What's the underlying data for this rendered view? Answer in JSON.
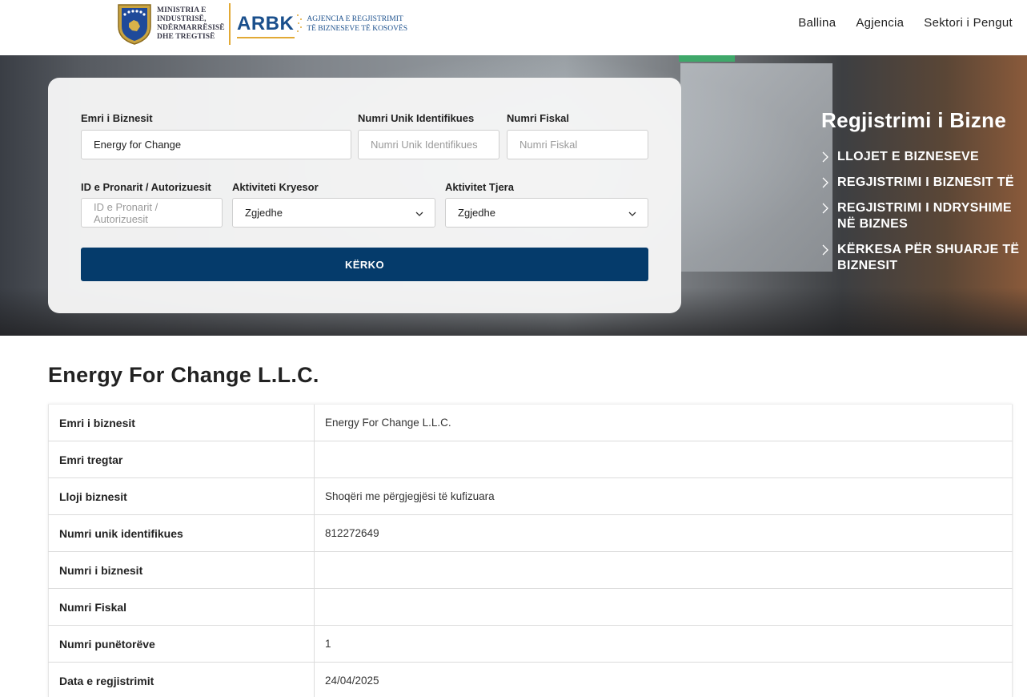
{
  "header": {
    "ministry_line1": "MINISTRIA E",
    "ministry_line2": "INDUSTRISË,",
    "ministry_line3": "NDËRMARRËSISË",
    "ministry_line4": "DHE TREGTISË",
    "arbk": "ARBK",
    "agency_line1": "AGJENCIA E REGJISTRIMIT",
    "agency_line2": "TË BIZNESEVE TË KOSOVËS",
    "nav": [
      "Ballina",
      "Agjencia",
      "Sektori i Pengut"
    ]
  },
  "search": {
    "business_name_label": "Emri i Biznesit",
    "business_name_value": "Energy for Change",
    "nui_label": "Numri Unik Identifikues",
    "nui_placeholder": "Numri Unik Identifikues",
    "fiscal_label": "Numri Fiskal",
    "fiscal_placeholder": "Numri Fiskal",
    "owner_label": "ID e Pronarit / Autorizuesit",
    "owner_placeholder": "ID e Pronarit / Autorizuesit",
    "main_activity_label": "Aktiviteti Kryesor",
    "main_activity_value": "Zgjedhe",
    "other_activity_label": "Aktivitet Tjera",
    "other_activity_value": "Zgjedhe",
    "button": "KËRKO"
  },
  "hero": {
    "title": "Regjistrimi i Bizne",
    "items": [
      [
        "LLOJET E BIZNESEVE"
      ],
      [
        "REGJISTRIMI I BIZNESIT TË"
      ],
      [
        "REGJISTRIMI I NDRYSHIME",
        "NË BIZNES"
      ],
      [
        "KËRKESA PËR SHUARJE TË",
        "BIZNESIT"
      ]
    ]
  },
  "result": {
    "title": "Energy For Change L.L.C.",
    "rows": [
      {
        "key": "Emri i biznesit",
        "value": "Energy For Change L.L.C."
      },
      {
        "key": "Emri tregtar",
        "value": ""
      },
      {
        "key": "Lloji biznesit",
        "value": "Shoqëri me përgjegjësi të kufizuara"
      },
      {
        "key": "Numri unik identifikues",
        "value": "812272649"
      },
      {
        "key": "Numri i biznesit",
        "value": ""
      },
      {
        "key": "Numri Fiskal",
        "value": ""
      },
      {
        "key": "Numri punëtorëve",
        "value": "1"
      },
      {
        "key": "Data e regjistrimit",
        "value": "24/04/2025"
      }
    ]
  },
  "colors": {
    "primary_button": "#053b6b",
    "arbk_blue": "#1a4f8c",
    "gold": "#e2a935"
  }
}
